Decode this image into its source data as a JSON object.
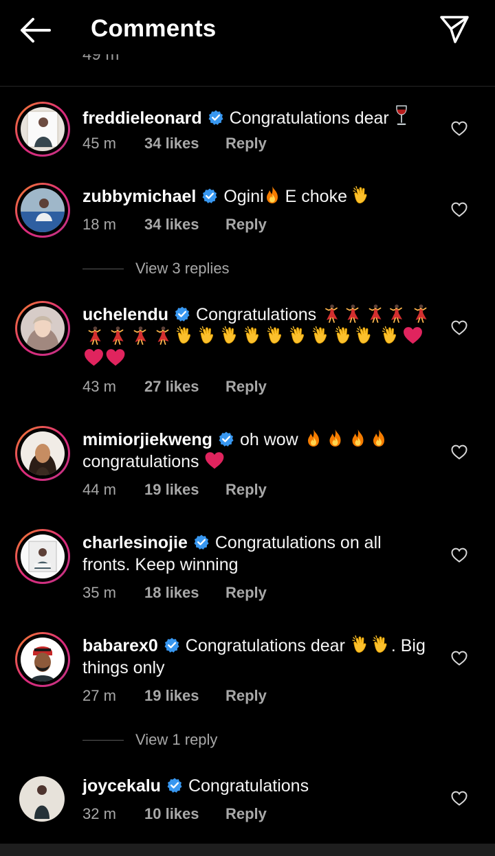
{
  "header": {
    "title": "Comments"
  },
  "partial_timestamp": "49 m",
  "comments": [
    {
      "username": "freddieleonard",
      "text": "Congratulations dear",
      "emojis": [
        "wine-glass"
      ],
      "time": "45 m",
      "likes": "34 likes",
      "reply": "Reply"
    },
    {
      "username": "zubbymichael",
      "text": "Ogini",
      "text_b": "E choke",
      "emojis": [
        "fire",
        "clap"
      ],
      "time": "18 m",
      "likes": "34 likes",
      "reply": "Reply",
      "view_replies": "View 3 replies"
    },
    {
      "username": "uchelendu",
      "text": "Congratulations",
      "emojis": [
        "dancer x9",
        "clap x10",
        "heart x3"
      ],
      "time": "43 m",
      "likes": "27 likes",
      "reply": "Reply"
    },
    {
      "username": "mimiorjiekweng",
      "text": "oh wow",
      "text_b": "congratulations",
      "emojis": [
        "fire x4",
        "heart"
      ],
      "time": "44 m",
      "likes": "19 likes",
      "reply": "Reply"
    },
    {
      "username": "charlesinojie",
      "text": "Congratulations on all fronts. Keep winning",
      "time": "35 m",
      "likes": "18 likes",
      "reply": "Reply"
    },
    {
      "username": "babarex0",
      "text": "Congratulations dear",
      "text_b": ". Big things only",
      "emojis": [
        "clap x2"
      ],
      "time": "27 m",
      "likes": "19 likes",
      "reply": "Reply",
      "view_replies": "View 1 reply"
    },
    {
      "username": "joycekalu",
      "text": "Congratulations",
      "time": "32 m",
      "likes": "10 likes",
      "reply": "Reply"
    }
  ],
  "colors": {
    "background": "#000000",
    "verified": "#3897f0",
    "meta": "#a8a8a8",
    "story_ring_start": "#f58529",
    "story_ring_end": "#c13584"
  }
}
